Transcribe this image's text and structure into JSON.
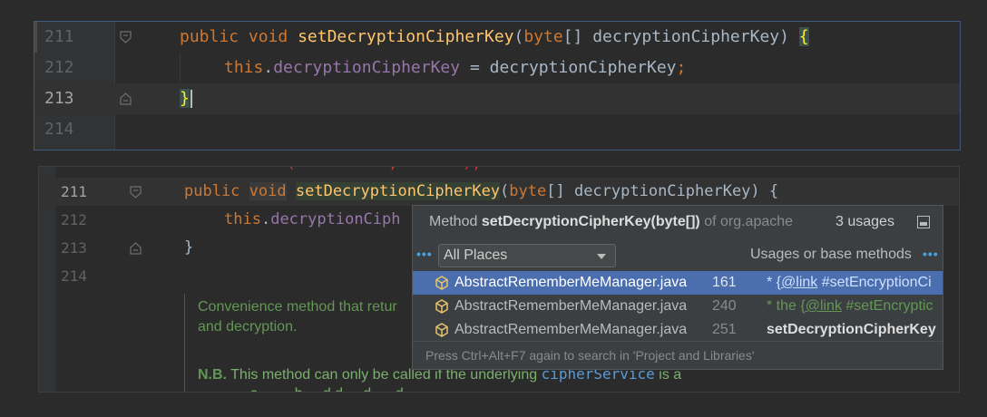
{
  "top_editor": {
    "lines": [
      {
        "num": "211",
        "kw1": "public",
        "kw2": "void",
        "fn": "setDecryptionCipherKey",
        "p1": "(",
        "type": "byte",
        "p2": "[] decryptionCipherKey) ",
        "brace": "{"
      },
      {
        "num": "212",
        "this_kw": "this",
        "dot": ".",
        "field": "decryptionCipherKey",
        "rest": " = decryptionCipherKey",
        "semi": ";"
      },
      {
        "num": "213",
        "brace": "}"
      },
      {
        "num": "214"
      }
    ]
  },
  "bottom_editor": {
    "stray_text": "           (          ,       );",
    "lines": [
      {
        "num": "211",
        "kw1": "public",
        "kw2": "void",
        "fn": "setDecryptionCipherKey",
        "p1": "(",
        "type": "byte",
        "p2": "[] decryptionCipherKey) {"
      },
      {
        "num": "212",
        "this_kw": "this",
        "dot": ".",
        "field": "decryptionCiph"
      },
      {
        "num": "213",
        "brace": "}"
      },
      {
        "num": "214"
      }
    ],
    "doc": {
      "line1": "Convenience method that retur",
      "line2": "and decryption.",
      "nb_label": "N.B.",
      "nb_text": " This method can only be called if the underlying ",
      "code_ref": "cipherService",
      "nb_tail": " is a",
      "line_cut": "             a         b     d d     d      d      "
    }
  },
  "popup": {
    "header": {
      "prefix": "Method ",
      "method": "setDecryptionCipherKey(byte[])",
      "suffix": " of org.apache",
      "count": "3 usages"
    },
    "scope": "All Places",
    "filter_label": "Usages or base methods",
    "results": [
      {
        "file": "AbstractRememberMeManager.java",
        "line": "161",
        "ctx_pre": "* ",
        "ctx_link": "{@link",
        "ctx_post": " #setEncryptionCi",
        "selected": true
      },
      {
        "file": "AbstractRememberMeManager.java",
        "line": "240",
        "ctx_pre": "* the ",
        "ctx_link": "{@link",
        "ctx_post": " #setEncryptic",
        "selected": false
      },
      {
        "file": "AbstractRememberMeManager.java",
        "line": "251",
        "ctx_bold": "setDecryptionCipherKey",
        "selected": false
      }
    ],
    "footer": "Press Ctrl+Alt+F7 again to search in 'Project and Libraries'"
  },
  "colors": {
    "keyword": "#cc7832",
    "function": "#ffc66d",
    "field": "#9876aa",
    "doc_comment": "#629755",
    "selection": "#4b6eaf"
  }
}
